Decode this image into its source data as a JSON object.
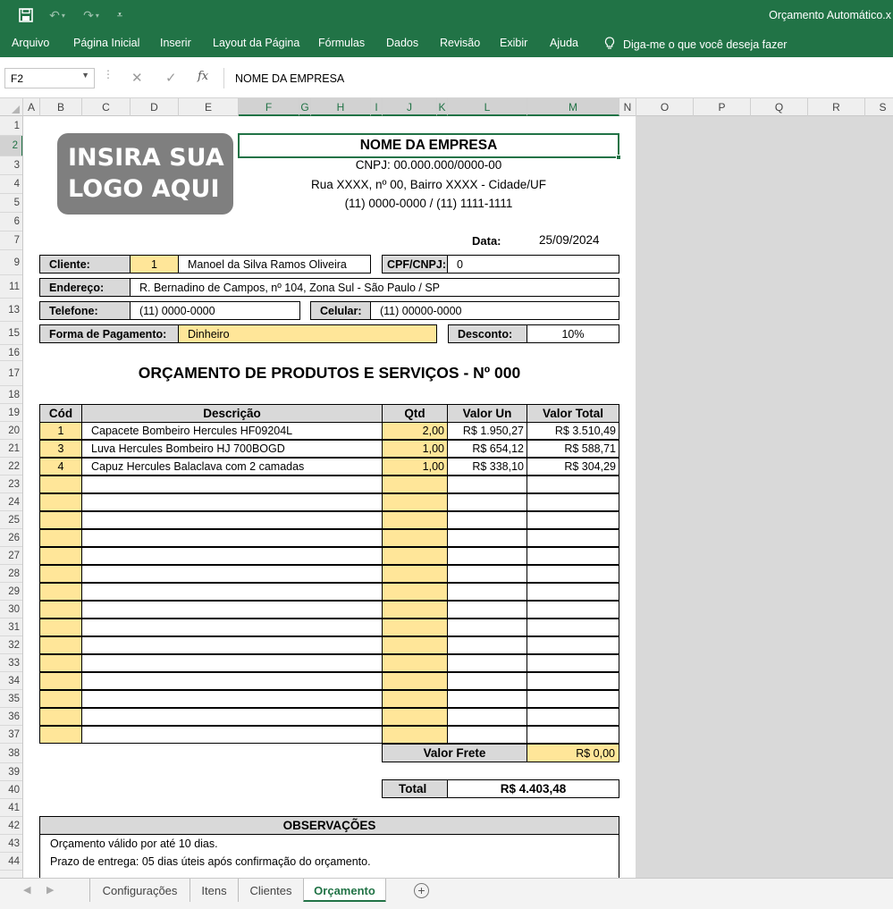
{
  "window": {
    "title": "Orçamento Automático.x",
    "quick_access": {
      "save_icon": "save-icon",
      "undo_icon": "undo-icon",
      "redo_icon": "redo-icon",
      "customize_icon": "customize-icon"
    }
  },
  "ribbon": {
    "tabs": [
      "Arquivo",
      "Página Inicial",
      "Inserir",
      "Layout da Página",
      "Fórmulas",
      "Dados",
      "Revisão",
      "Exibir",
      "Ajuda"
    ],
    "tell_me": "Diga-me o que você deseja fazer"
  },
  "formula_bar": {
    "name_box": "F2",
    "formula": "NOME DA EMPRESA",
    "fx": "fx"
  },
  "columns": [
    "A",
    "B",
    "C",
    "D",
    "E",
    "F",
    "G",
    "H",
    "I",
    "J",
    "K",
    "L",
    "M",
    "N",
    "O",
    "P",
    "Q",
    "R",
    "S"
  ],
  "rows": [
    "1",
    "2",
    "3",
    "4",
    "5",
    "6",
    "7",
    "9",
    "11",
    "13",
    "15",
    "16",
    "17",
    "18",
    "19",
    "20",
    "21",
    "22",
    "23",
    "24",
    "25",
    "26",
    "27",
    "28",
    "29",
    "30",
    "31",
    "32",
    "33",
    "34",
    "35",
    "36",
    "37",
    "38",
    "39",
    "40",
    "41",
    "42",
    "43",
    "44"
  ],
  "sheet": {
    "logo_line1": "INSIRA SUA",
    "logo_line2": "LOGO AQUI",
    "company_name": "NOME DA EMPRESA",
    "cnpj": "CNPJ: 00.000.000/0000-00",
    "address": "Rua XXXX, nº 00, Bairro XXXX - Cidade/UF",
    "phones": "(11) 0000-0000 / (11) 1111-1111",
    "date_label": "Data:",
    "date_value": "25/09/2024",
    "client_label": "Cliente:",
    "client_code": "1",
    "client_name": "Manoel da Silva Ramos Oliveira",
    "cpf_label": "CPF/CNPJ:",
    "cpf_value": "0",
    "address_label": "Endereço:",
    "address_value": "R. Bernadino de Campos, nº 104, Zona Sul  -  São Paulo / SP",
    "phone_label": "Telefone:",
    "phone_value": "(11) 0000-0000",
    "cell_label": "Celular:",
    "cell_value": "(11) 00000-0000",
    "payment_label": "Forma de Pagamento:",
    "payment_value": "Dinheiro",
    "discount_label": "Desconto:",
    "discount_value": "10%",
    "budget_title": "ORÇAMENTO DE PRODUTOS E SERVIÇOS - Nº 000",
    "table_headers": {
      "cod": "Cód",
      "desc": "Descrição",
      "qtd": "Qtd",
      "unit": "Valor Un",
      "total": "Valor Total"
    },
    "items": [
      {
        "cod": "1",
        "desc": "Capacete Bombeiro Hercules HF09204L",
        "qtd": "2,00",
        "unit": "R$ 1.950,27",
        "total": "R$ 3.510,49"
      },
      {
        "cod": "3",
        "desc": "Luva Hercules Bombeiro HJ 700BOGD",
        "qtd": "1,00",
        "unit": "R$ 654,12",
        "total": "R$ 588,71"
      },
      {
        "cod": "4",
        "desc": "Capuz Hercules Balaclava com 2 camadas",
        "qtd": "1,00",
        "unit": "R$ 338,10",
        "total": "R$ 304,29"
      }
    ],
    "freight_label": "Valor Frete",
    "freight_value": "R$ 0,00",
    "total_label": "Total",
    "total_value": "R$ 4.403,48",
    "obs_title": "OBSERVAÇÕES",
    "obs_line1": "Orçamento válido por até 10 dias.",
    "obs_line2": "Prazo de entrega: 05 dias úteis após confirmação do orçamento."
  },
  "sheet_tabs": [
    "Configurações",
    "Itens",
    "Clientes",
    "Orçamento"
  ],
  "active_sheet": "Orçamento",
  "colors": {
    "excel_green": "#217346",
    "label_grey": "#d9d9d9",
    "input_yellow": "#ffe699"
  }
}
